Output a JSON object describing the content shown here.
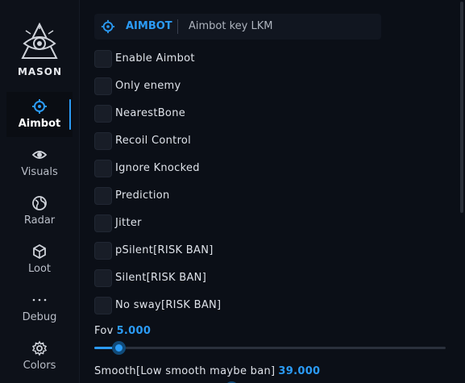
{
  "brand": {
    "name": "MASON"
  },
  "sidebar": {
    "items": [
      {
        "label": "Aimbot",
        "icon": "crosshair-icon",
        "active": true
      },
      {
        "label": "Visuals",
        "icon": "eye-icon",
        "active": false
      },
      {
        "label": "Radar",
        "icon": "globe-icon",
        "active": false
      },
      {
        "label": "Loot",
        "icon": "box-icon",
        "active": false
      },
      {
        "label": "Debug",
        "icon": "dots-icon",
        "active": false
      },
      {
        "label": "Colors",
        "icon": "gear-icon",
        "active": false
      }
    ]
  },
  "header": {
    "title": "AIMBOT",
    "key_label": "Aimbot key LKM",
    "icon": "crosshair-icon"
  },
  "options": [
    {
      "label": "Enable Aimbot",
      "checked": false
    },
    {
      "label": "Only enemy",
      "checked": false
    },
    {
      "label": "NearestBone",
      "checked": false
    },
    {
      "label": "Recoil Control",
      "checked": false
    },
    {
      "label": "Ignore Knocked",
      "checked": false
    },
    {
      "label": "Prediction",
      "checked": false
    },
    {
      "label": "Jitter",
      "checked": false
    },
    {
      "label": "pSilent[RISK BAN]",
      "checked": false
    },
    {
      "label": "Silent[RISK BAN]",
      "checked": false
    },
    {
      "label": "No sway[RISK BAN]",
      "checked": false
    }
  ],
  "sliders": {
    "fov": {
      "label": "Fov",
      "value": "5.000",
      "fraction": 0.068
    },
    "smooth": {
      "label": "Smooth[Low smooth maybe ban]",
      "value": "39.000",
      "fraction": 0.39
    }
  },
  "colors": {
    "accent": "#2b9bf5",
    "background": "#0b0f17",
    "sidebar": "#0d1119"
  }
}
